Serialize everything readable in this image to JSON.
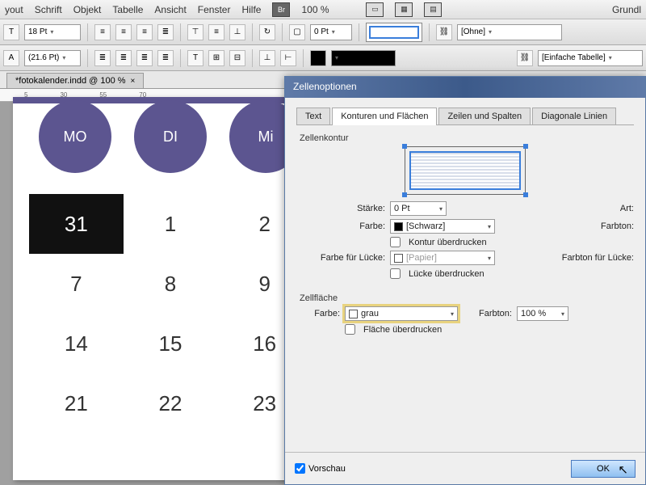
{
  "menu": {
    "items": [
      "yout",
      "Schrift",
      "Objekt",
      "Tabelle",
      "Ansicht",
      "Fenster",
      "Hilfe"
    ],
    "zoom": "100 %",
    "br": "Br",
    "right_label": "Grundl"
  },
  "toolbar": {
    "font_size": "18 Pt",
    "leading": "(21.6 Pt)",
    "ptfield": "0 Pt",
    "style_none": "[Ohne]",
    "style_simple": "[Einfache Tabelle]"
  },
  "tab": {
    "name": "*fotokalender.indd @ 100 %"
  },
  "ruler": {
    "marks": [
      "5",
      "30",
      "55",
      "70"
    ]
  },
  "calendar": {
    "days": [
      "MO",
      "DI",
      "Mi"
    ],
    "rows": [
      [
        "31",
        "1",
        "2"
      ],
      [
        "7",
        "8",
        "9"
      ],
      [
        "14",
        "15",
        "16"
      ],
      [
        "21",
        "22",
        "23"
      ]
    ]
  },
  "dialog": {
    "title": "Zellenoptionen",
    "tabs": [
      "Text",
      "Konturen und Flächen",
      "Zeilen und Spalten",
      "Diagonale Linien"
    ],
    "groups": {
      "kontur": "Zellenkontur",
      "flaeche": "Zellfläche"
    },
    "labels": {
      "staerke": "Stärke:",
      "farbe": "Farbe:",
      "art": "Art:",
      "farbton": "Farbton:",
      "luecke_farbe": "Farbe für Lücke:",
      "luecke_ton": "Farbton für Lücke:",
      "kontur_ueber": "Kontur überdrucken",
      "luecke_ueber": "Lücke überdrucken",
      "flaeche_ueber": "Fläche überdrucken"
    },
    "values": {
      "stroke_weight": "0 Pt",
      "stroke_color": "[Schwarz]",
      "gap_color": "[Papier]",
      "fill_color": "grau",
      "fill_tint": "100 %"
    },
    "footer": {
      "preview": "Vorschau",
      "ok": "OK"
    }
  }
}
